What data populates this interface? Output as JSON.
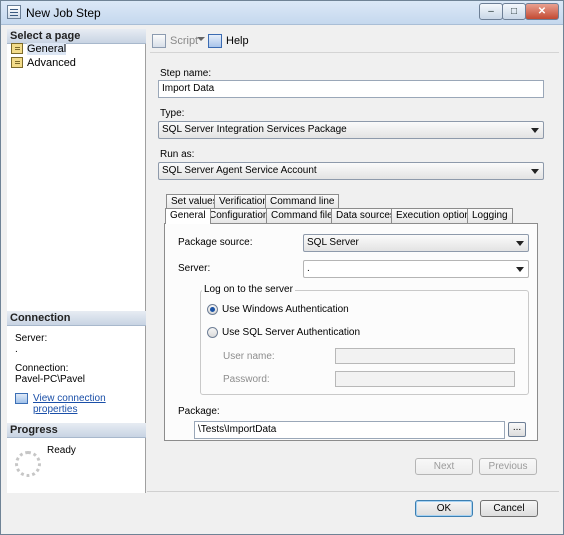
{
  "window": {
    "title": "New Job Step"
  },
  "left": {
    "select_page_header": "Select a page",
    "pages": [
      {
        "label": "General",
        "selected": true
      },
      {
        "label": "Advanced",
        "selected": false
      }
    ],
    "connection_header": "Connection",
    "server_label": "Server:",
    "server_value": ".",
    "connection_label": "Connection:",
    "connection_value": "Pavel-PC\\Pavel",
    "view_connection_link": "View connection properties",
    "progress_header": "Progress",
    "progress_status": "Ready"
  },
  "toolbar": {
    "script_label": "Script",
    "help_label": "Help"
  },
  "form": {
    "step_name_label": "Step name:",
    "step_name_value": "Import Data",
    "type_label": "Type:",
    "type_value": "SQL Server Integration Services Package",
    "run_as_label": "Run as:",
    "run_as_value": "SQL Server Agent Service Account"
  },
  "tabs": {
    "row1": [
      "Set values",
      "Verification",
      "Command line"
    ],
    "row2": [
      "General",
      "Configurations",
      "Command files",
      "Data sources",
      "Execution options",
      "Logging"
    ],
    "active": "General"
  },
  "general_tab": {
    "package_source_label": "Package source:",
    "package_source_value": "SQL Server",
    "server_label": "Server:",
    "server_value": ".",
    "logon_group_label": "Log on to the server",
    "windows_auth_label": "Use Windows Authentication",
    "sql_auth_label": "Use SQL Server Authentication",
    "auth_selected": "windows",
    "user_name_label": "User name:",
    "password_label": "Password:",
    "package_label": "Package:",
    "package_value": "\\Tests\\ImportData",
    "browse_label": "..."
  },
  "nav_buttons": {
    "next_label": "Next",
    "previous_label": "Previous"
  },
  "footer": {
    "ok_label": "OK",
    "cancel_label": "Cancel"
  }
}
